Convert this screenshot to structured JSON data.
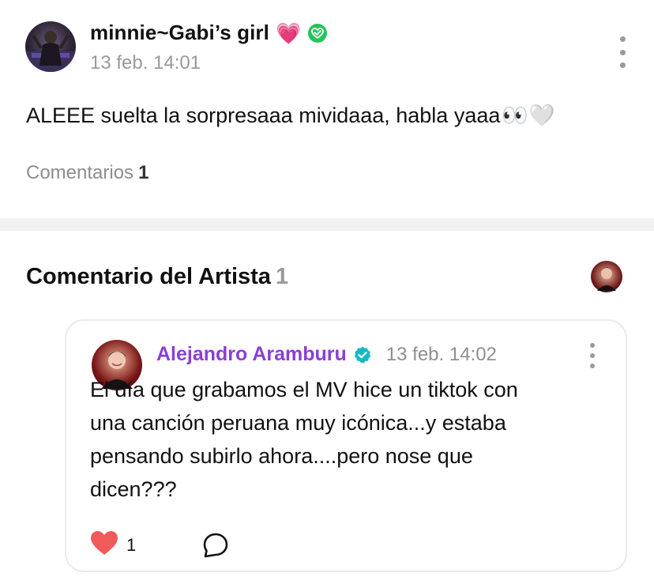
{
  "post": {
    "author": "minnie~Gabi’s girl",
    "author_emoji": "💗",
    "time": "13 feb. 14:01",
    "body": "ALEEE suelta la sorpresaaa mividaaa, habla yaaa",
    "body_emojis": "👀🤍",
    "comments_label": "Comentarios",
    "comments_count": "1"
  },
  "artist_section": {
    "heading": "Comentario del Artista",
    "count": "1",
    "comment": {
      "author": "Alejandro Aramburu",
      "time": "13 feb. 14:02",
      "lines": [
        "El día que grabamos el MV hice un tiktok con",
        "una canción peruana muy icónica...y estaba",
        "pensando subirlo ahora....pero nose que",
        "dicen???"
      ],
      "likes": "1"
    }
  },
  "colors": {
    "artist_name": "#8a3fd6",
    "verified_green": "#22c55e",
    "verified_teal": "#16b8c6",
    "heart": "#f05a5a",
    "muted_text": "#9a9a9a",
    "divider": "#f1f1f3"
  },
  "icons": {
    "post_verified": "verified-check-icon",
    "artist_verified": "verified-badge-icon",
    "more": "more-vertical-icon",
    "like": "heart-icon",
    "reply": "comment-bubble-icon"
  }
}
